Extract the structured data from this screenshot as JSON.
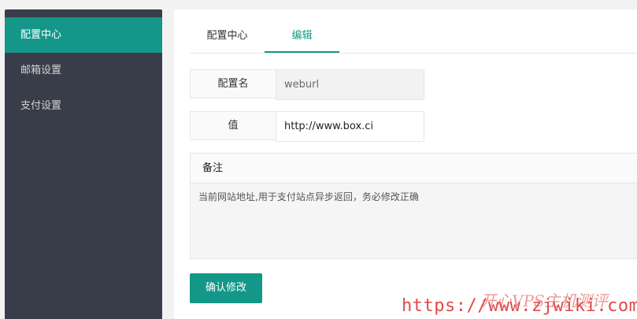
{
  "sidebar": {
    "items": [
      {
        "label": "配置中心",
        "active": true
      },
      {
        "label": "邮箱设置",
        "active": false
      },
      {
        "label": "支付设置",
        "active": false
      }
    ]
  },
  "tabs": [
    {
      "label": "配置中心",
      "active": false
    },
    {
      "label": "编辑",
      "active": true
    }
  ],
  "form": {
    "name_label": "配置名",
    "name_value": "weburl",
    "value_label": "值",
    "value_value": "http://www.box.ci",
    "remark_label": "备注",
    "remark_value": "当前网站地址,用于支付站点异步返回，务必修改正确",
    "submit_label": "确认修改"
  },
  "watermark": {
    "logo_text": "开心VPS主机测评",
    "url_text": "https://www.zjwiki.com"
  },
  "colors": {
    "sidebar_bg": "#393d49",
    "accent": "#149788",
    "tab_active_text": "#0f9d80"
  }
}
